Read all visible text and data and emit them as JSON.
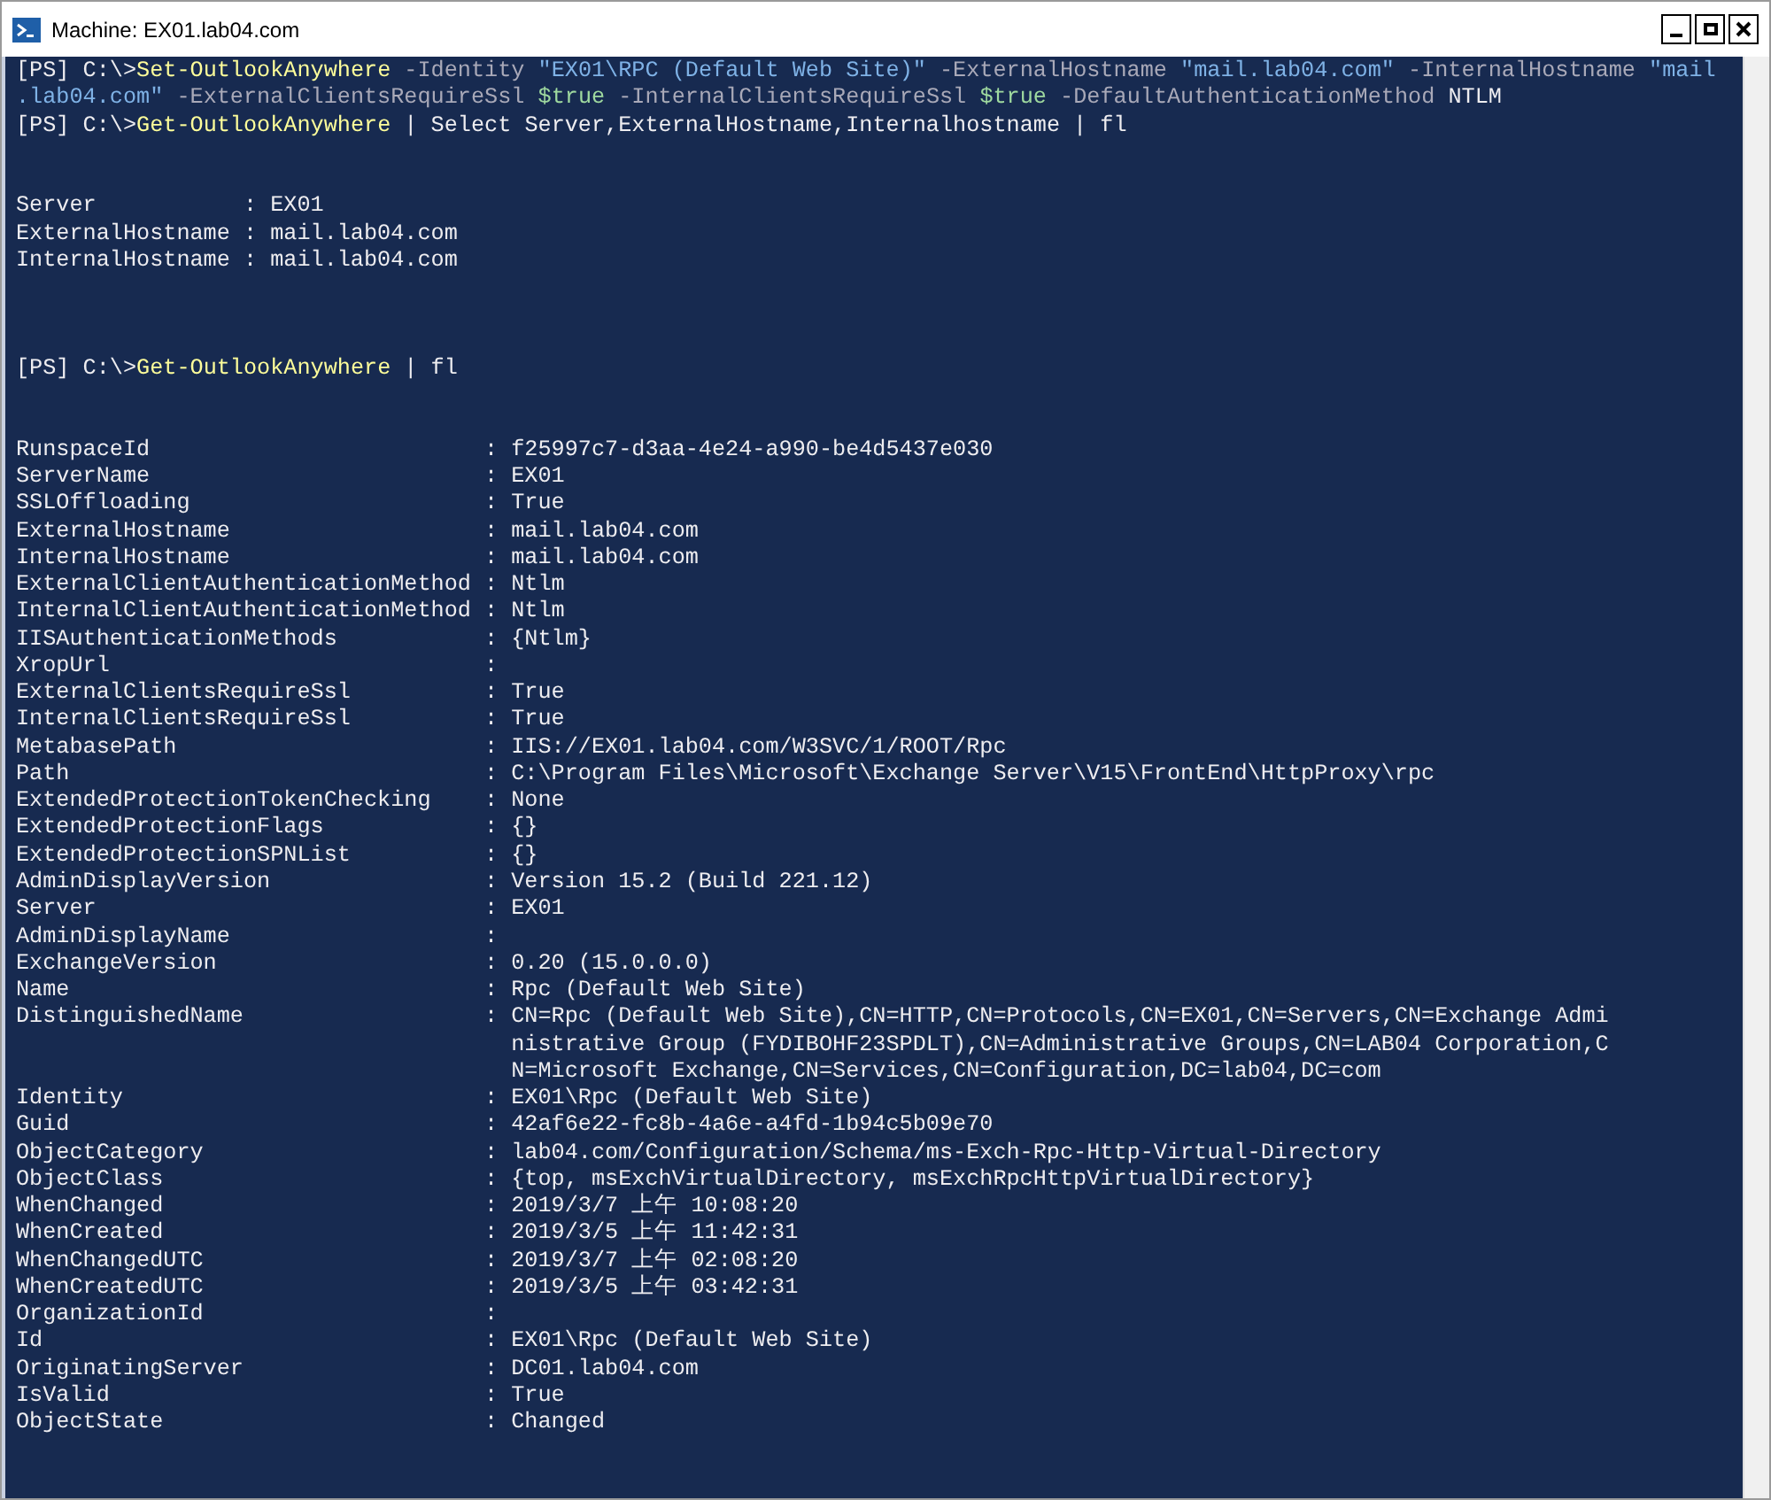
{
  "window": {
    "title": "Machine: EX01.lab04.com"
  },
  "console": {
    "lines": [
      {
        "kind": "text",
        "segments": [
          {
            "kind": "plain",
            "text": "[PS] C:\\>"
          },
          {
            "kind": "command",
            "text": "Set-OutlookAnywhere"
          },
          {
            "kind": "parameter",
            "text": " -Identity "
          },
          {
            "kind": "string",
            "text": "\"EX01\\RPC (Default Web Site)\""
          },
          {
            "kind": "parameter",
            "text": " -ExternalHostname "
          },
          {
            "kind": "string",
            "text": "\"mail.lab04.com\""
          },
          {
            "kind": "parameter",
            "text": " -InternalHostname "
          },
          {
            "kind": "string",
            "text": "\"mail"
          }
        ]
      },
      {
        "kind": "text",
        "segments": [
          {
            "kind": "string",
            "text": ".lab04.com\""
          },
          {
            "kind": "parameter",
            "text": " -ExternalClientsRequireSsl "
          },
          {
            "kind": "variable",
            "text": "$true"
          },
          {
            "kind": "parameter",
            "text": " -InternalClientsRequireSsl "
          },
          {
            "kind": "variable",
            "text": "$true"
          },
          {
            "kind": "parameter",
            "text": " -DefaultAuthenticationMethod "
          },
          {
            "kind": "plain",
            "text": "NTLM"
          }
        ]
      },
      {
        "kind": "text",
        "segments": [
          {
            "kind": "plain",
            "text": "[PS] C:\\>"
          },
          {
            "kind": "command",
            "text": "Get-OutlookAnywhere"
          },
          {
            "kind": "plain",
            "text": " | Select Server,ExternalHostname,Internalhostname | fl"
          }
        ]
      },
      {
        "kind": "blank"
      },
      {
        "kind": "blank"
      },
      {
        "kind": "text",
        "segments": [
          {
            "kind": "plain",
            "text": "Server           : EX01"
          }
        ]
      },
      {
        "kind": "text",
        "segments": [
          {
            "kind": "plain",
            "text": "ExternalHostname : mail.lab04.com"
          }
        ]
      },
      {
        "kind": "text",
        "segments": [
          {
            "kind": "plain",
            "text": "InternalHostname : mail.lab04.com"
          }
        ]
      },
      {
        "kind": "blank"
      },
      {
        "kind": "blank"
      },
      {
        "kind": "blank"
      },
      {
        "kind": "text",
        "segments": [
          {
            "kind": "plain",
            "text": "[PS] C:\\>"
          },
          {
            "kind": "command",
            "text": "Get-OutlookAnywhere"
          },
          {
            "kind": "plain",
            "text": " | fl"
          }
        ]
      },
      {
        "kind": "blank"
      },
      {
        "kind": "blank"
      },
      {
        "kind": "text",
        "segments": [
          {
            "kind": "plain",
            "text": "RunspaceId                         : f25997c7-d3aa-4e24-a990-be4d5437e030"
          }
        ]
      },
      {
        "kind": "text",
        "segments": [
          {
            "kind": "plain",
            "text": "ServerName                         : EX01"
          }
        ]
      },
      {
        "kind": "text",
        "segments": [
          {
            "kind": "plain",
            "text": "SSLOffloading                      : True"
          }
        ]
      },
      {
        "kind": "text",
        "segments": [
          {
            "kind": "plain",
            "text": "ExternalHostname                   : mail.lab04.com"
          }
        ]
      },
      {
        "kind": "text",
        "segments": [
          {
            "kind": "plain",
            "text": "InternalHostname                   : mail.lab04.com"
          }
        ]
      },
      {
        "kind": "text",
        "segments": [
          {
            "kind": "plain",
            "text": "ExternalClientAuthenticationMethod : Ntlm"
          }
        ]
      },
      {
        "kind": "text",
        "segments": [
          {
            "kind": "plain",
            "text": "InternalClientAuthenticationMethod : Ntlm"
          }
        ]
      },
      {
        "kind": "text",
        "segments": [
          {
            "kind": "plain",
            "text": "IISAuthenticationMethods           : {Ntlm}"
          }
        ]
      },
      {
        "kind": "text",
        "segments": [
          {
            "kind": "plain",
            "text": "XropUrl                            :"
          }
        ]
      },
      {
        "kind": "text",
        "segments": [
          {
            "kind": "plain",
            "text": "ExternalClientsRequireSsl          : True"
          }
        ]
      },
      {
        "kind": "text",
        "segments": [
          {
            "kind": "plain",
            "text": "InternalClientsRequireSsl          : True"
          }
        ]
      },
      {
        "kind": "text",
        "segments": [
          {
            "kind": "plain",
            "text": "MetabasePath                       : IIS://EX01.lab04.com/W3SVC/1/ROOT/Rpc"
          }
        ]
      },
      {
        "kind": "text",
        "segments": [
          {
            "kind": "plain",
            "text": "Path                               : C:\\Program Files\\Microsoft\\Exchange Server\\V15\\FrontEnd\\HttpProxy\\rpc"
          }
        ]
      },
      {
        "kind": "text",
        "segments": [
          {
            "kind": "plain",
            "text": "ExtendedProtectionTokenChecking    : None"
          }
        ]
      },
      {
        "kind": "text",
        "segments": [
          {
            "kind": "plain",
            "text": "ExtendedProtectionFlags            : {}"
          }
        ]
      },
      {
        "kind": "text",
        "segments": [
          {
            "kind": "plain",
            "text": "ExtendedProtectionSPNList          : {}"
          }
        ]
      },
      {
        "kind": "text",
        "segments": [
          {
            "kind": "plain",
            "text": "AdminDisplayVersion                : Version 15.2 (Build 221.12)"
          }
        ]
      },
      {
        "kind": "text",
        "segments": [
          {
            "kind": "plain",
            "text": "Server                             : EX01"
          }
        ]
      },
      {
        "kind": "text",
        "segments": [
          {
            "kind": "plain",
            "text": "AdminDisplayName                   :"
          }
        ]
      },
      {
        "kind": "text",
        "segments": [
          {
            "kind": "plain",
            "text": "ExchangeVersion                    : 0.20 (15.0.0.0)"
          }
        ]
      },
      {
        "kind": "text",
        "segments": [
          {
            "kind": "plain",
            "text": "Name                               : Rpc (Default Web Site)"
          }
        ]
      },
      {
        "kind": "text",
        "segments": [
          {
            "kind": "plain",
            "text": "DistinguishedName                  : CN=Rpc (Default Web Site),CN=HTTP,CN=Protocols,CN=EX01,CN=Servers,CN=Exchange Admi"
          }
        ]
      },
      {
        "kind": "text",
        "segments": [
          {
            "kind": "plain",
            "text": "                                     nistrative Group (FYDIBOHF23SPDLT),CN=Administrative Groups,CN=LAB04 Corporation,C"
          }
        ]
      },
      {
        "kind": "text",
        "segments": [
          {
            "kind": "plain",
            "text": "                                     N=Microsoft Exchange,CN=Services,CN=Configuration,DC=lab04,DC=com"
          }
        ]
      },
      {
        "kind": "text",
        "segments": [
          {
            "kind": "plain",
            "text": "Identity                           : EX01\\Rpc (Default Web Site)"
          }
        ]
      },
      {
        "kind": "text",
        "segments": [
          {
            "kind": "plain",
            "text": "Guid                               : 42af6e22-fc8b-4a6e-a4fd-1b94c5b09e70"
          }
        ]
      },
      {
        "kind": "text",
        "segments": [
          {
            "kind": "plain",
            "text": "ObjectCategory                     : lab04.com/Configuration/Schema/ms-Exch-Rpc-Http-Virtual-Directory"
          }
        ]
      },
      {
        "kind": "text",
        "segments": [
          {
            "kind": "plain",
            "text": "ObjectClass                        : {top, msExchVirtualDirectory, msExchRpcHttpVirtualDirectory}"
          }
        ]
      },
      {
        "kind": "text",
        "segments": [
          {
            "kind": "plain",
            "text": "WhenChanged                        : 2019/3/7 上午 10:08:20"
          }
        ]
      },
      {
        "kind": "text",
        "segments": [
          {
            "kind": "plain",
            "text": "WhenCreated                        : 2019/3/5 上午 11:42:31"
          }
        ]
      },
      {
        "kind": "text",
        "segments": [
          {
            "kind": "plain",
            "text": "WhenChangedUTC                     : 2019/3/7 上午 02:08:20"
          }
        ]
      },
      {
        "kind": "text",
        "segments": [
          {
            "kind": "plain",
            "text": "WhenCreatedUTC                     : 2019/3/5 上午 03:42:31"
          }
        ]
      },
      {
        "kind": "text",
        "segments": [
          {
            "kind": "plain",
            "text": "OrganizationId                     :"
          }
        ]
      },
      {
        "kind": "text",
        "segments": [
          {
            "kind": "plain",
            "text": "Id                                 : EX01\\Rpc (Default Web Site)"
          }
        ]
      },
      {
        "kind": "text",
        "segments": [
          {
            "kind": "plain",
            "text": "OriginatingServer                  : DC01.lab04.com"
          }
        ]
      },
      {
        "kind": "text",
        "segments": [
          {
            "kind": "plain",
            "text": "IsValid                            : True"
          }
        ]
      },
      {
        "kind": "text",
        "segments": [
          {
            "kind": "plain",
            "text": "ObjectState                        : Changed"
          }
        ]
      }
    ]
  }
}
